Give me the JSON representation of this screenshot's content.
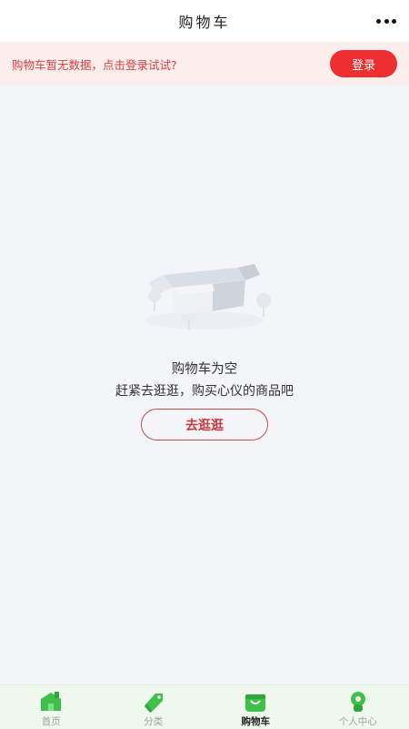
{
  "header": {
    "title": "购物车"
  },
  "login_bar": {
    "message": "购物车暂无数据，点击登录试试?",
    "button_label": "登录"
  },
  "empty_state": {
    "title": "购物车为空",
    "subtitle": "赶紧去逛逛，购买心仪的商品吧",
    "button_label": "去逛逛"
  },
  "tabbar": {
    "items": [
      {
        "label": "首页",
        "icon": "home-icon"
      },
      {
        "label": "分类",
        "icon": "tag-icon"
      },
      {
        "label": "购物车",
        "icon": "shopping-bag-icon",
        "active": true
      },
      {
        "label": "个人中心",
        "icon": "user-icon"
      }
    ]
  },
  "colors": {
    "accent_red": "#ef2f2f",
    "tab_green": "#3fc04a",
    "banner_bg": "#fdeeee"
  }
}
